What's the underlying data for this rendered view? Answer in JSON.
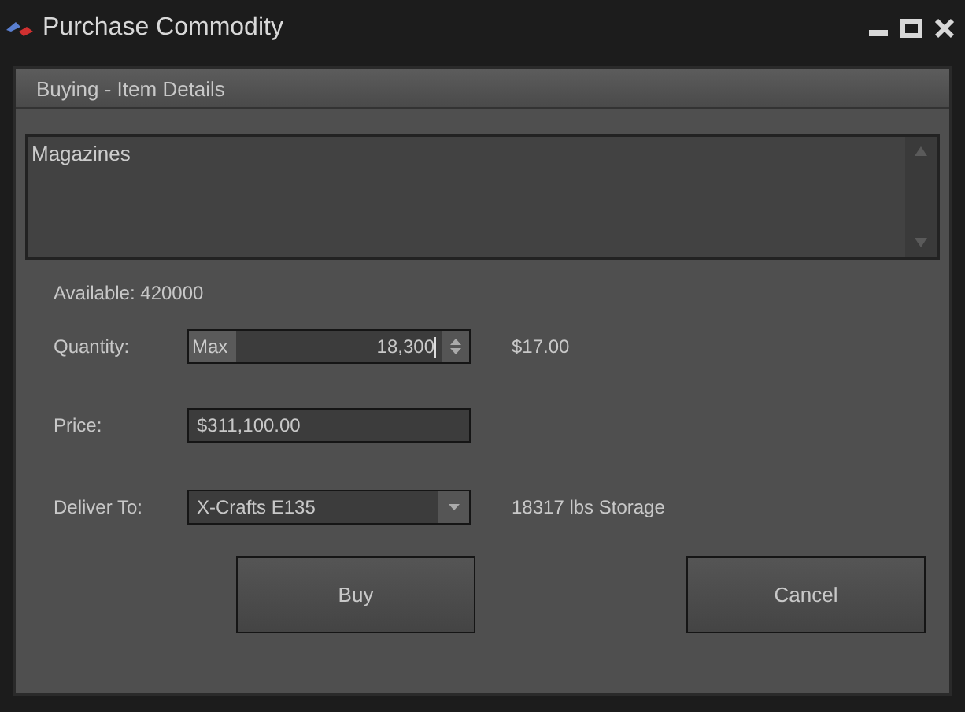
{
  "window": {
    "title": "Purchase Commodity"
  },
  "panel": {
    "title": "Buying - Item Details"
  },
  "description": {
    "value": "Magazines"
  },
  "available": "Available: 420000",
  "quantity": {
    "label": "Quantity:",
    "max_button": "Max",
    "value": "18,300",
    "unit_price": "$17.00"
  },
  "price": {
    "label": "Price:",
    "value": "$311,100.00"
  },
  "deliver": {
    "label": "Deliver To:",
    "value": "X-Crafts E135",
    "storage": "18317 lbs Storage"
  },
  "buttons": [
    "Buy",
    "Cancel"
  ]
}
